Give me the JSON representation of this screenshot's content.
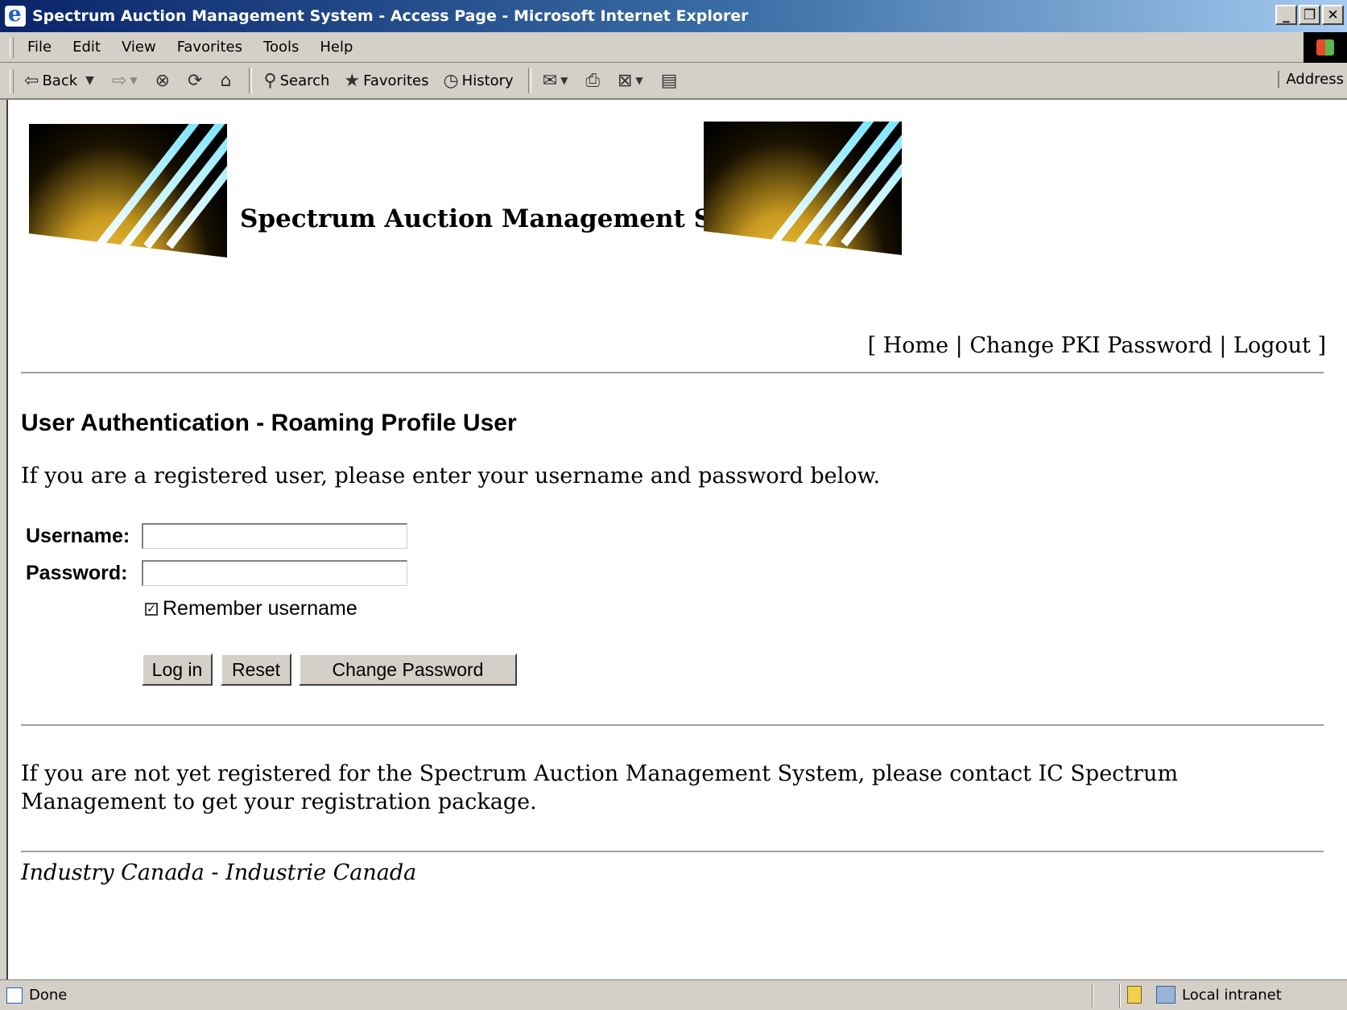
{
  "window": {
    "title": "Spectrum Auction Management System - Access Page - Microsoft Internet Explorer",
    "controls": [
      "_",
      "❐",
      "✕"
    ]
  },
  "menu": [
    "File",
    "Edit",
    "View",
    "Favorites",
    "Tools",
    "Help"
  ],
  "toolbar": {
    "back": "Back",
    "search": "Search",
    "favorites": "Favorites",
    "history": "History",
    "address": "Address"
  },
  "page": {
    "site_title": "Spectrum Auction Management System",
    "nav": {
      "open": "[ ",
      "home": "Home",
      "sep1": " | ",
      "change_pki": "Change PKI Password",
      "sep2": " | ",
      "logout": "Logout",
      "close": " ]"
    },
    "heading": "User Authentication - Roaming Profile User",
    "intro": "If you are a registered user, please enter your username and password below.",
    "form": {
      "username_label": "Username:",
      "username_value": "",
      "password_label": "Password:",
      "password_value": "",
      "remember_label": "Remember username",
      "remember_checked": true,
      "login_button": "Log in",
      "reset_button": "Reset",
      "change_password_button": "Change Password"
    },
    "notice": "If you are not yet registered for the Spectrum Auction Management System, please contact IC Spectrum Management to get your registration package.",
    "footer": "Industry Canada - Industrie Canada"
  },
  "status": {
    "text": "Done",
    "zone": "Local intranet"
  }
}
